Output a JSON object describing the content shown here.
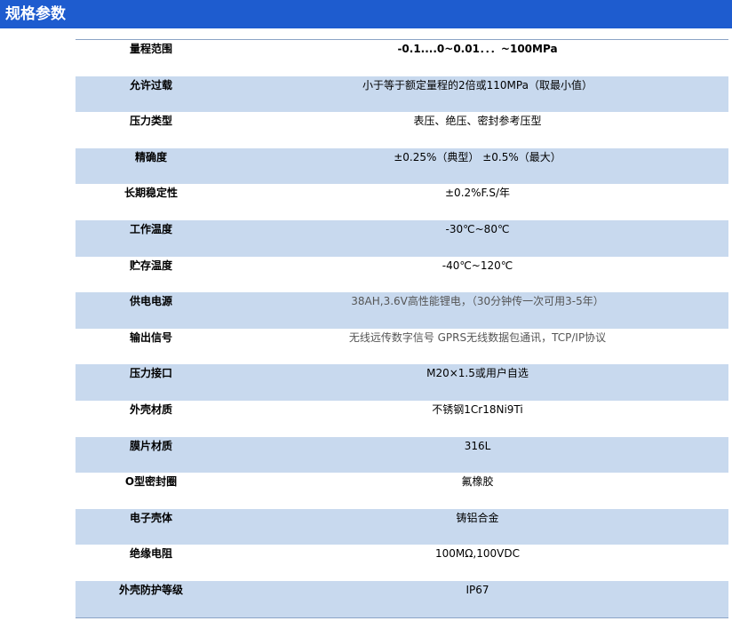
{
  "header": {
    "title": "规格参数"
  },
  "rows": [
    {
      "label": "量程范围",
      "value": "-0.1....0~0.01．．．~100MPa",
      "style": "bold"
    },
    {
      "label": "允许过载",
      "value": "小于等于额定量程的2倍或110MPa（取最小值）",
      "style": ""
    },
    {
      "label": "压力类型",
      "value": "表压、绝压、密封参考压型",
      "style": ""
    },
    {
      "label": "精确度",
      "value": "±0.25%（典型） ±0.5%（最大）",
      "style": ""
    },
    {
      "label": "长期稳定性",
      "value": "±0.2%F.S/年",
      "style": ""
    },
    {
      "label": "工作温度",
      "value": "-30℃~80℃",
      "style": ""
    },
    {
      "label": "贮存温度",
      "value": "-40℃~120℃",
      "style": ""
    },
    {
      "label": "供电电源",
      "value": "38AH,3.6V高性能锂电，（30分钟传一次可用3-5年）",
      "style": "gray"
    },
    {
      "label": "输出信号",
      "value": "无线远传数字信号 GPRS无线数据包通讯，TCP/IP协议",
      "style": "gray"
    },
    {
      "label": "压力接口",
      "value": "M20×1.5或用户自选",
      "style": ""
    },
    {
      "label": "外壳材质",
      "value": "不锈钢1Cr18Ni9Ti",
      "style": ""
    },
    {
      "label": "膜片材质",
      "value": "316L",
      "style": ""
    },
    {
      "label": "O型密封圈",
      "value": "氟橡胶",
      "style": ""
    },
    {
      "label": "电子壳体",
      "value": "铸铝合金",
      "style": ""
    },
    {
      "label": "绝缘电阻",
      "value": "100MΩ,100VDC",
      "style": ""
    },
    {
      "label": "外壳防护等级",
      "value": "IP67",
      "style": ""
    }
  ],
  "colors": {
    "header_bg": "#1e5ccf",
    "row_shade": "#c8d9ee",
    "border": "#8ba4c6"
  }
}
